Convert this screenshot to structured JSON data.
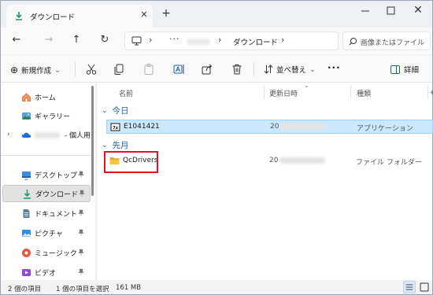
{
  "window": {
    "tab_title": "ダウンロード",
    "tab_close": "✕",
    "new_tab": "+",
    "close": "✕"
  },
  "nav": {
    "back": "←",
    "forward": "→",
    "up": "↑",
    "refresh": "↻",
    "sep": "›",
    "more": "···",
    "current": "ダウンロード",
    "search_placeholder": "画像またはファイル"
  },
  "toolbar": {
    "new_label": "新規作成",
    "sort_label": "並べ替え",
    "more": "···",
    "details_label": "詳細",
    "plus": "⊕",
    "caret": "⌄"
  },
  "sidebar": {
    "items": [
      {
        "label": "ホーム",
        "icon": "home-icon"
      },
      {
        "label": "ギャラリー",
        "icon": "gallery-icon"
      },
      {
        "label": " - 個人用",
        "icon": "cloud-icon"
      },
      {
        "label": "デスクトップ",
        "icon": "desktop-icon"
      },
      {
        "label": "ダウンロード",
        "icon": "download-icon"
      },
      {
        "label": "ドキュメント",
        "icon": "document-icon"
      },
      {
        "label": "ピクチャ",
        "icon": "pictures-icon"
      },
      {
        "label": "ミュージック",
        "icon": "music-icon"
      },
      {
        "label": "ビデオ",
        "icon": "video-icon"
      }
    ],
    "pin": "📌",
    "chevron": "›"
  },
  "content": {
    "columns": [
      "名前",
      "更新日時",
      "種類",
      "サ"
    ],
    "sort_indicator": "⌄",
    "groups": [
      {
        "label": "今日",
        "rows": [
          {
            "name": "E1041421",
            "date_prefix": "20",
            "type": "アプリケーション",
            "icon": "archive-exe-icon"
          }
        ]
      },
      {
        "label": "先月",
        "rows": [
          {
            "name": "QcDrivers",
            "date_prefix": "20",
            "type": "ファイル フォルダー",
            "icon": "folder-icon"
          }
        ]
      }
    ],
    "group_chevron": "⌄"
  },
  "status": {
    "count": "2 個の項目",
    "selection": "1 個の項目を選択",
    "size": "161 MB"
  },
  "colors": {
    "accent": "#1a5fb4",
    "selection_bg": "#cce8ff",
    "highlight_border": "#e0141f",
    "download_green": "#1e9e6a",
    "folder_yellow": "#f6c443"
  }
}
